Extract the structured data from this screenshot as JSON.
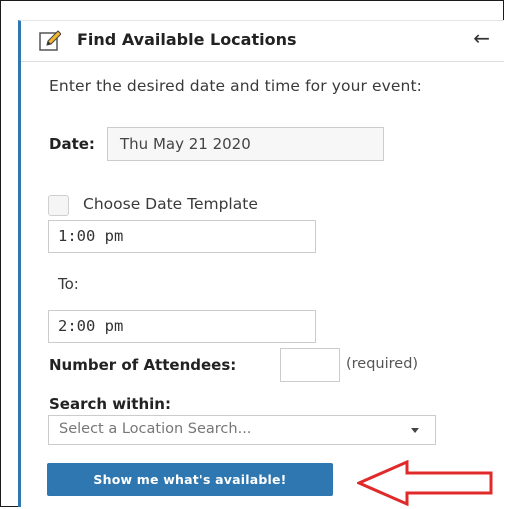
{
  "panel": {
    "title": "Find Available Locations",
    "back_symbol": "←",
    "edit_icon": "edit-pencil-icon",
    "accent_color": "#2f77b0"
  },
  "form": {
    "instructions": "Enter the desired date and time for your event:",
    "date_label": "Date:",
    "date_value": "Thu May 21 2020",
    "date_template_label": "Choose Date Template",
    "start_time": "1:00 pm",
    "to_label": "To:",
    "end_time": "2:00 pm",
    "attendees_label": "Number of Attendees:",
    "attendees_value": "",
    "attendees_required": "(required)",
    "search_within_label": "Search within:",
    "search_select_value": "Select a Location Search...",
    "submit_label": "Show me what's available!"
  },
  "annotation": {
    "arrow_color": "#e02a2a",
    "arrow_icon": "left-arrow-outline"
  }
}
